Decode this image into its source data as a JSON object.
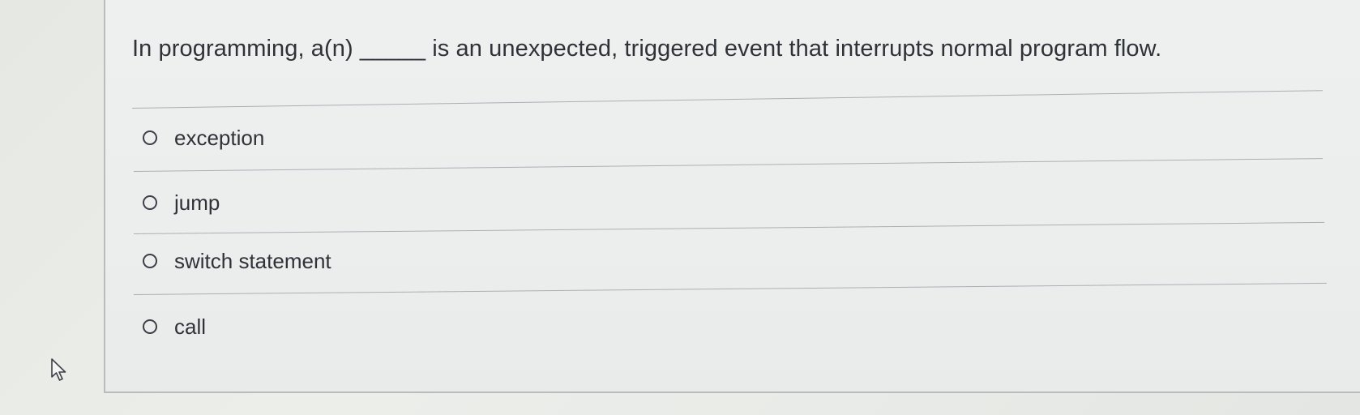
{
  "question": {
    "text": "In programming, a(n) _____ is an unexpected, triggered event that interrupts normal program flow."
  },
  "options": [
    {
      "label": "exception",
      "selected": false
    },
    {
      "label": "jump",
      "selected": false
    },
    {
      "label": "switch statement",
      "selected": false
    },
    {
      "label": "call",
      "selected": false
    }
  ],
  "icons": {
    "radio": "radio-button-icon",
    "cursor": "mouse-pointer-icon"
  },
  "colors": {
    "background": "#e9ebe8",
    "card": "#eceeee",
    "text": "#2f3338",
    "divider": "#a9b0b4"
  }
}
